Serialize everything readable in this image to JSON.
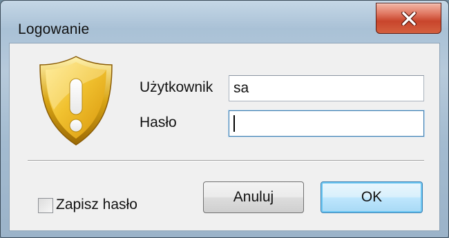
{
  "window": {
    "title": "Logowanie"
  },
  "form": {
    "username_label": "Użytkownik",
    "username_value": "sa",
    "password_label": "Hasło",
    "password_value": ""
  },
  "footer": {
    "remember_label": "Zapisz hasło",
    "remember_checked": false,
    "cancel_label": "Anuluj",
    "ok_label": "OK"
  },
  "icons": {
    "close": "close-icon",
    "warning": "warning-shield-icon"
  },
  "colors": {
    "close_button": "#c8452c",
    "shield_gold": "#e8b21e",
    "focus_border": "#3d7bad"
  }
}
